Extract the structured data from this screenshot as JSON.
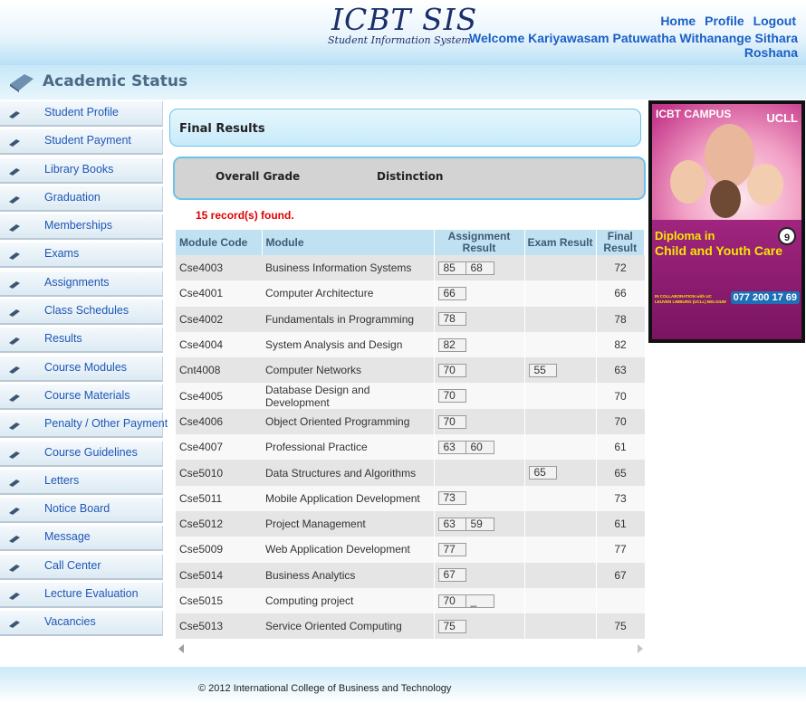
{
  "header": {
    "logo_title": "ICBT SIS",
    "logo_subtitle": "Student Information System",
    "welcome_text": "Welcome Kariyawasam Patuwatha Withanange Sithara Roshana",
    "links": {
      "home": "Home",
      "profile": "Profile",
      "logout": "Logout"
    }
  },
  "section": {
    "title": "Academic Status",
    "icon": "diamond-icon"
  },
  "sidebar": {
    "items": [
      {
        "label": "Student Profile"
      },
      {
        "label": "Student Payment"
      },
      {
        "label": "Library Books"
      },
      {
        "label": "Graduation"
      },
      {
        "label": "Memberships"
      },
      {
        "label": "Exams"
      },
      {
        "label": "Assignments"
      },
      {
        "label": "Class Schedules"
      },
      {
        "label": "Results"
      },
      {
        "label": "Course Modules"
      },
      {
        "label": "Course Materials"
      },
      {
        "label": "Penalty / Other Payment"
      },
      {
        "label": "Course Guidelines"
      },
      {
        "label": "Letters"
      },
      {
        "label": "Notice Board"
      },
      {
        "label": "Message"
      },
      {
        "label": "Call Center"
      },
      {
        "label": "Lecture Evaluation"
      },
      {
        "label": "Vacancies"
      }
    ]
  },
  "main": {
    "panel_title": "Final Results",
    "overall_grade_label": "Overall Grade",
    "overall_grade_value": "Distinction",
    "record_count": "15 record(s) found.",
    "table": {
      "headers": {
        "code": "Module Code",
        "module": "Module",
        "assignment": "Assignment Result",
        "exam": "Exam Result",
        "final": "Final Result"
      },
      "rows": [
        {
          "code": "Cse4003",
          "module": "Business Information Systems",
          "assignment": [
            "85",
            "68"
          ],
          "exam": [],
          "final": "72"
        },
        {
          "code": "Cse4001",
          "module": "Computer Architecture",
          "assignment": [
            "66"
          ],
          "exam": [],
          "final": "66"
        },
        {
          "code": "Cse4002",
          "module": "Fundamentals in Programming",
          "assignment": [
            "78"
          ],
          "exam": [],
          "final": "78"
        },
        {
          "code": "Cse4004",
          "module": "System Analysis and Design",
          "assignment": [
            "82"
          ],
          "exam": [],
          "final": "82"
        },
        {
          "code": "Cnt4008",
          "module": "Computer Networks",
          "assignment": [
            "70"
          ],
          "exam": [
            "55"
          ],
          "final": "63"
        },
        {
          "code": "Cse4005",
          "module": "Database Design and Development",
          "assignment": [
            "70"
          ],
          "exam": [],
          "final": "70"
        },
        {
          "code": "Cse4006",
          "module": "Object Oriented Programming",
          "assignment": [
            "70"
          ],
          "exam": [],
          "final": "70"
        },
        {
          "code": "Cse4007",
          "module": "Professional Practice",
          "assignment": [
            "63",
            "60"
          ],
          "exam": [],
          "final": "61"
        },
        {
          "code": "Cse5010",
          "module": "Data Structures and Algorithms",
          "assignment": [],
          "exam": [
            "65"
          ],
          "final": "65"
        },
        {
          "code": "Cse5011",
          "module": "Mobile Application Development",
          "assignment": [
            "73"
          ],
          "exam": [],
          "final": "73"
        },
        {
          "code": "Cse5012",
          "module": "Project Management",
          "assignment": [
            "63",
            "59"
          ],
          "exam": [],
          "final": "61"
        },
        {
          "code": "Cse5009",
          "module": "Web Application Development",
          "assignment": [
            "77"
          ],
          "exam": [],
          "final": "77"
        },
        {
          "code": "Cse5014",
          "module": "Business Analytics",
          "assignment": [
            "67"
          ],
          "exam": [],
          "final": "67"
        },
        {
          "code": "Cse5015",
          "module": "Computing project",
          "assignment": [
            "70",
            "_"
          ],
          "exam": [],
          "final": ""
        },
        {
          "code": "Cse5013",
          "module": "Service Oriented Computing",
          "assignment": [
            "75"
          ],
          "exam": [],
          "final": "75"
        }
      ]
    }
  },
  "ad": {
    "logo_left": "ICBT CAMPUS",
    "logo_right": "UCLL",
    "title_line1": "Diploma in",
    "title_line2": "Child and Youth Care",
    "badge": "9",
    "phone": "077 200 17 69",
    "collab": "IN COLLABORATION with UC LEUVEN LIMBURG (UCLL) BELGIUM"
  },
  "footer": {
    "text": "© 2012 International College of Business and Technology"
  },
  "colors": {
    "link_blue": "#1a5fc8",
    "header_blue": "#bfe1f1",
    "record_red": "#e00000"
  }
}
